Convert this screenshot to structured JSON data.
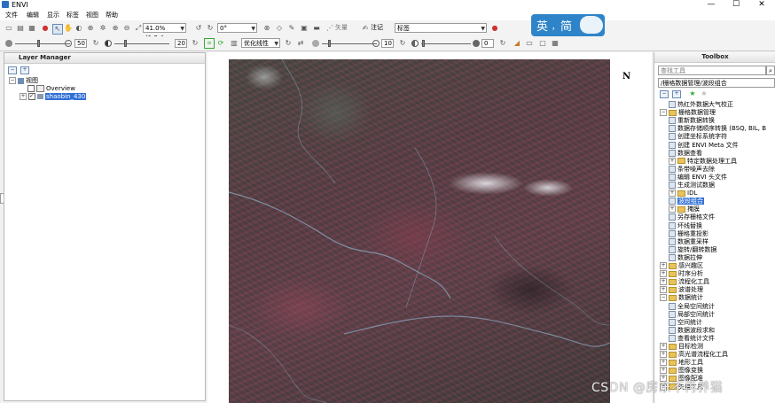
{
  "window": {
    "title": "ENVI",
    "controls": [
      "—",
      "☐",
      "✕"
    ]
  },
  "menu": [
    {
      "label": "文件"
    },
    {
      "label": "编辑"
    },
    {
      "label": "显示"
    },
    {
      "label": "标签"
    },
    {
      "label": "视图"
    },
    {
      "label": "帮助"
    }
  ],
  "toolbar1": {
    "zoom_value": "41.0% (1:2.4",
    "rotate_value": "0°",
    "vector_label": "矢量",
    "annotation_label": "注记",
    "annotation_value": "标签"
  },
  "toolbar2": {
    "brightness_value": "50",
    "contrast_value": "20",
    "stretch_value": "优化线性",
    "sharpen_value": "10",
    "transparency_value": "0"
  },
  "layer_manager": {
    "title": "Layer Manager",
    "root_label": "视图",
    "items": [
      {
        "label": "Overview",
        "checked": false
      },
      {
        "label": "shaobin_430",
        "checked": true,
        "selected": true
      }
    ]
  },
  "image_view": {
    "north_label": "N"
  },
  "toolbox": {
    "title": "Toolbox",
    "search_placeholder": "查找工具",
    "path": "/栅格数据管理/波段组合",
    "items": [
      {
        "label": "热红外数据大气校正",
        "level": 2,
        "type": "tool"
      },
      {
        "label": "栅格数据管理",
        "level": 1,
        "type": "folder",
        "expanded": true
      },
      {
        "label": "重新数据转换",
        "level": 2,
        "type": "tool"
      },
      {
        "label": "数据存储顺序转换 (BSQ, BIL, B",
        "level": 2,
        "type": "tool"
      },
      {
        "label": "创建坐标系统字符",
        "level": 2,
        "type": "tool"
      },
      {
        "label": "创建 ENVI Meta 文件",
        "level": 2,
        "type": "tool"
      },
      {
        "label": "数据查看",
        "level": 2,
        "type": "tool"
      },
      {
        "label": "特定数据处理工具",
        "level": 2,
        "type": "folder"
      },
      {
        "label": "条带噪声去除",
        "level": 2,
        "type": "tool"
      },
      {
        "label": "编辑 ENVI 头文件",
        "level": 2,
        "type": "tool"
      },
      {
        "label": "生成测试数据",
        "level": 2,
        "type": "tool"
      },
      {
        "label": "IDL",
        "level": 2,
        "type": "folder"
      },
      {
        "label": "波段组合",
        "level": 2,
        "type": "tool",
        "selected": true
      },
      {
        "label": "掩膜",
        "level": 2,
        "type": "folder"
      },
      {
        "label": "另存栅格文件",
        "level": 2,
        "type": "tool"
      },
      {
        "label": "坏线替换",
        "level": 2,
        "type": "tool"
      },
      {
        "label": "栅格重投影",
        "level": 2,
        "type": "tool"
      },
      {
        "label": "数据重采样",
        "level": 2,
        "type": "tool"
      },
      {
        "label": "旋转/翻转数据",
        "level": 2,
        "type": "tool"
      },
      {
        "label": "数据拉伸",
        "level": 2,
        "type": "tool"
      },
      {
        "label": "感兴趣区",
        "level": 1,
        "type": "folder"
      },
      {
        "label": "时序分析",
        "level": 1,
        "type": "folder"
      },
      {
        "label": "流程化工具",
        "level": 1,
        "type": "folder"
      },
      {
        "label": "波谱处理",
        "level": 1,
        "type": "folder"
      },
      {
        "label": "数据统计",
        "level": 1,
        "type": "folder",
        "expanded": true
      },
      {
        "label": "全局空间统计",
        "level": 2,
        "type": "tool"
      },
      {
        "label": "局部空间统计",
        "level": 2,
        "type": "tool"
      },
      {
        "label": "空间统计",
        "level": 2,
        "type": "tool"
      },
      {
        "label": "数据波段求和",
        "level": 2,
        "type": "tool"
      },
      {
        "label": "查看统计文件",
        "level": 2,
        "type": "tool"
      },
      {
        "label": "目标检测",
        "level": 1,
        "type": "folder"
      },
      {
        "label": "高光谱流程化工具",
        "level": 1,
        "type": "folder"
      },
      {
        "label": "地形工具",
        "level": 1,
        "type": "folder"
      },
      {
        "label": "图像变换",
        "level": 1,
        "type": "folder"
      },
      {
        "label": "图像配准",
        "level": 1,
        "type": "folder"
      },
      {
        "label": "矢量工具",
        "level": 1,
        "type": "folder"
      }
    ]
  },
  "ime_badge": {
    "en": "英",
    "dot": "，",
    "jian": "简"
  },
  "watermark": "CSDN @房东不再养猫",
  "colors": {
    "selection": "#3170d6",
    "ime_blue": "#2f84c9",
    "folder": "#e8c25a"
  }
}
